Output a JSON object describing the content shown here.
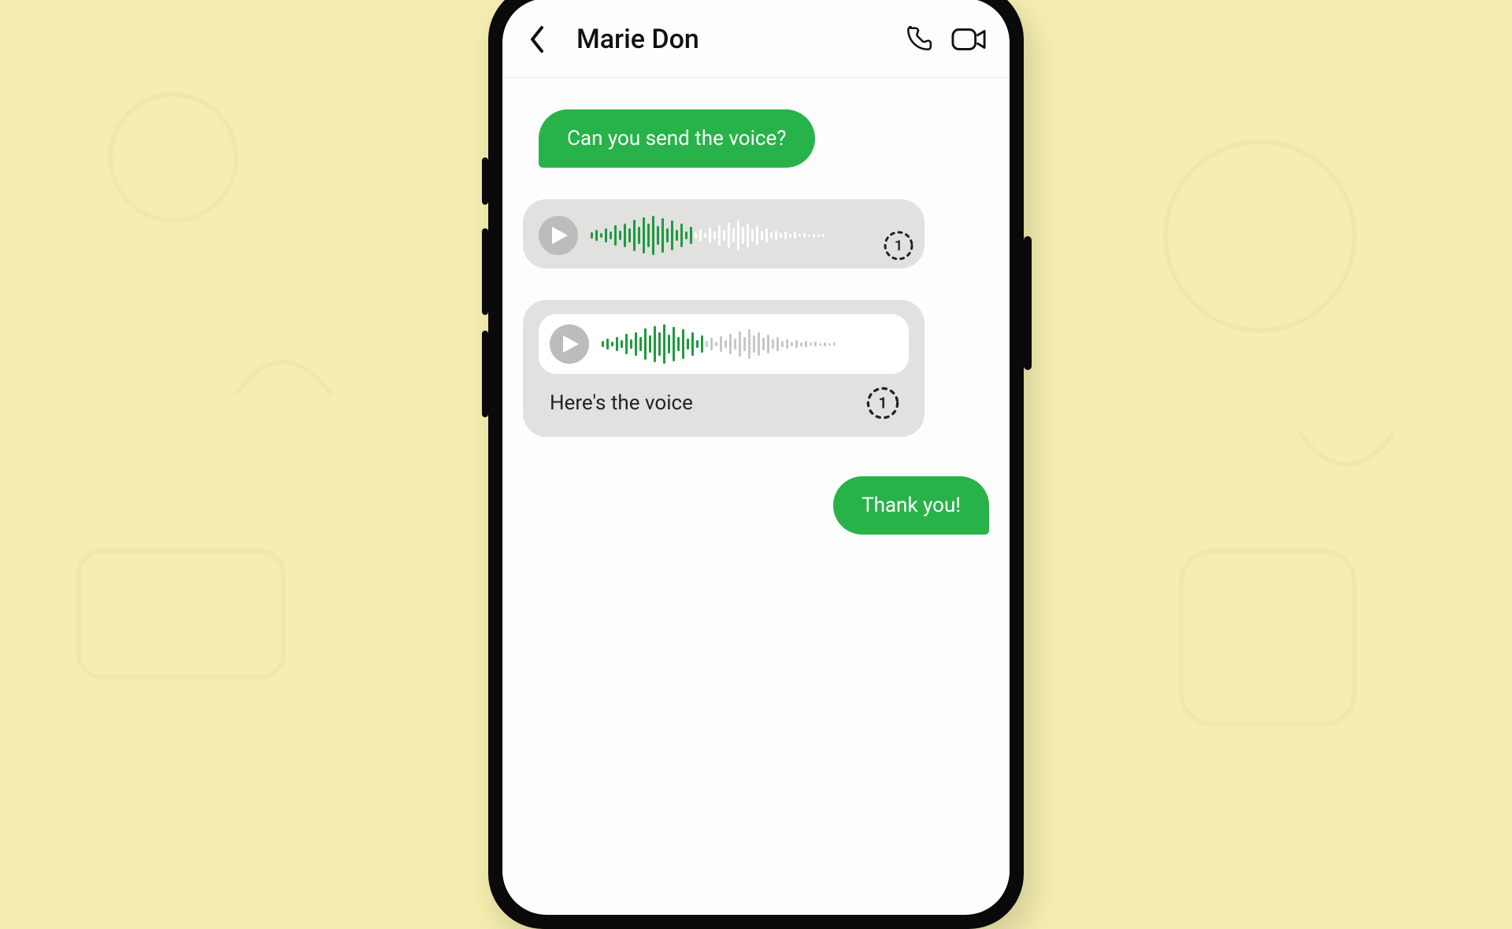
{
  "header": {
    "contact_name": "Marie Don"
  },
  "messages": {
    "m1_text": "Can you send the voice?",
    "m3_caption": "Here's the voice",
    "m4_text": "Thank you!"
  },
  "icons": {
    "view_once_label": "1"
  },
  "colors": {
    "accent_green": "#28b24a",
    "bubble_grey": "#e1e1e0",
    "background": "#f5eeb0"
  },
  "waveform": {
    "played_color": "#1f9a3e",
    "unplayed_color": "#ffffff",
    "muted_color": "#c7c7c7",
    "bars": [
      8,
      14,
      6,
      18,
      10,
      26,
      12,
      30,
      18,
      40,
      22,
      46,
      30,
      50,
      24,
      44,
      18,
      38,
      14,
      30,
      10,
      22,
      8,
      16,
      6,
      20,
      10,
      26,
      14,
      32,
      18,
      38,
      22,
      30,
      16,
      24,
      12,
      18,
      8,
      12,
      6,
      10,
      5,
      8,
      4,
      6,
      3,
      5,
      3,
      4
    ],
    "progress_index": 22
  }
}
